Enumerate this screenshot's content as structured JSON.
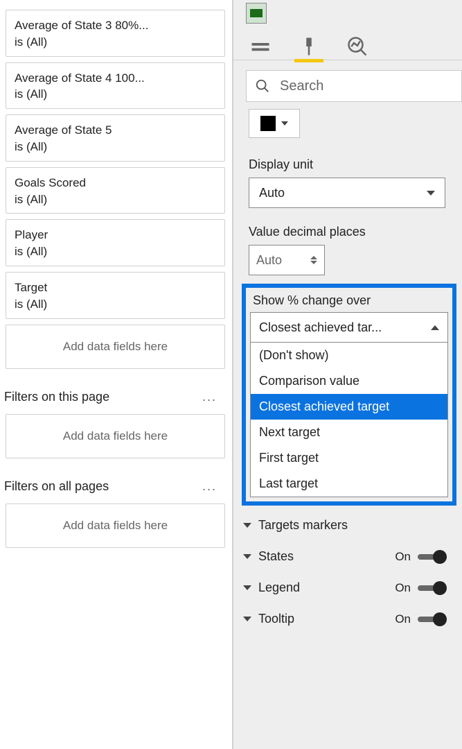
{
  "filters": {
    "visual_filters": [
      {
        "title": "Average of State 3 80%...",
        "sub": "is (All)"
      },
      {
        "title": "Average of State 4 100...",
        "sub": "is (All)"
      },
      {
        "title": "Average of State 5",
        "sub": "is (All)"
      },
      {
        "title": "Goals Scored",
        "sub": "is (All)"
      },
      {
        "title": "Player",
        "sub": "is (All)"
      },
      {
        "title": "Target",
        "sub": "is (All)"
      }
    ],
    "dropzone_text": "Add data fields here",
    "page_filters_header": "Filters on this page",
    "all_pages_header": "Filters on all pages"
  },
  "format": {
    "search_placeholder": "Search",
    "color_value": "#000000",
    "display_unit_label": "Display unit",
    "display_unit_value": "Auto",
    "decimal_label": "Value decimal places",
    "decimal_value": "Auto",
    "show_pct_label": "Show % change over",
    "show_pct_selected": "Closest achieved tar...",
    "show_pct_options": [
      "(Don't show)",
      "Comparison value",
      "Closest achieved target",
      "Next target",
      "First target",
      "Last target"
    ],
    "show_pct_selected_index": 2,
    "sections": [
      {
        "name": "Targets markers",
        "toggle": null
      },
      {
        "name": "States",
        "toggle": "On"
      },
      {
        "name": "Legend",
        "toggle": "On"
      },
      {
        "name": "Tooltip",
        "toggle": "On"
      }
    ]
  }
}
